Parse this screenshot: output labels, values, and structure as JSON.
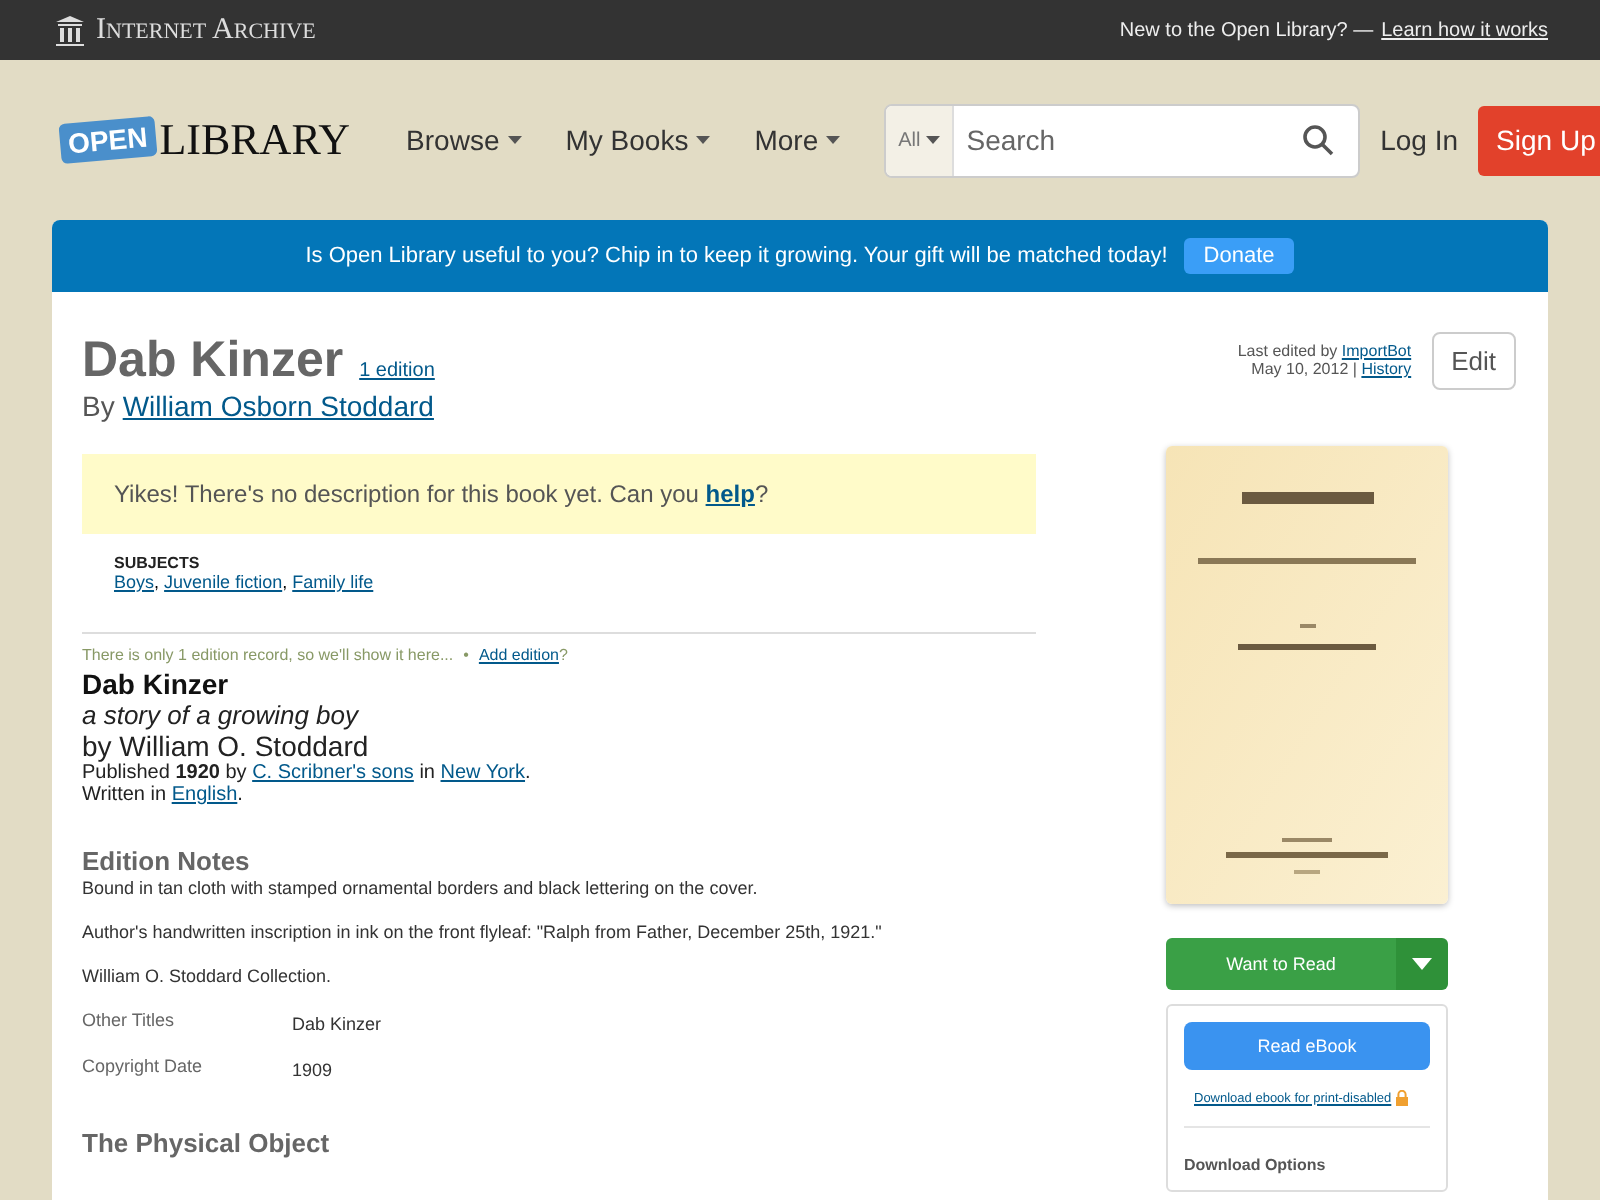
{
  "topbar": {
    "brand": "Internet Archive",
    "prompt": "New to the Open Library? —",
    "link": "Learn how it works"
  },
  "header": {
    "logo_badge": "OPEN",
    "logo_text": "LIBRARY",
    "nav": [
      "Browse",
      "My Books",
      "More"
    ],
    "search": {
      "scope": "All",
      "placeholder": "Search"
    },
    "login": "Log In",
    "signup": "Sign Up"
  },
  "banner": {
    "text": "Is Open Library useful to you? Chip in to keep it growing. Your gift will be matched today!",
    "button": "Donate"
  },
  "work": {
    "title": "Dab Kinzer",
    "editions_link": "1 edition",
    "by": "By",
    "author": "William Osborn Stoddard"
  },
  "meta": {
    "edited_prefix": "Last edited by",
    "editor": "ImportBot",
    "date": "May 10, 2012",
    "separator": "|",
    "history": "History",
    "edit_button": "Edit"
  },
  "description": {
    "text": "Yikes! There's no description for this book yet. Can you",
    "link": "help",
    "suffix": "?"
  },
  "subjects": {
    "heading": "SUBJECTS",
    "items": [
      "Boys",
      "Juvenile fiction",
      "Family life"
    ],
    "separator": ","
  },
  "edition": {
    "notice": "There is only 1 edition record, so we'll show it here...",
    "dot": "•",
    "add_link": "Add edition",
    "add_suffix": "?",
    "title": "Dab Kinzer",
    "subtitle": "a story of a growing boy",
    "byline": "by William O. Stoddard",
    "published": {
      "prefix": "Published",
      "year": "1920",
      "by": "by",
      "publisher": "C. Scribner's sons",
      "in": "in",
      "place": "New York",
      "end": "."
    },
    "written": {
      "prefix": "Written in",
      "language": "English",
      "end": "."
    }
  },
  "edition_notes": {
    "heading": "Edition Notes",
    "paragraphs": [
      "Bound in tan cloth with stamped ornamental borders and black lettering on the cover.",
      "Author's handwritten inscription in ink on the front flyleaf: \"Ralph from Father, December 25th, 1921.\"",
      "William O. Stoddard Collection."
    ],
    "fields": [
      {
        "label": "Other Titles",
        "value": "Dab Kinzer"
      },
      {
        "label": "Copyright Date",
        "value": "1909"
      }
    ]
  },
  "physical": {
    "heading": "The Physical Object"
  },
  "sidebar": {
    "want_to_read": "Want to Read",
    "read_ebook": "Read eBook",
    "download_link": "Download ebook for print-disabled",
    "download_heading": "Download Options"
  }
}
